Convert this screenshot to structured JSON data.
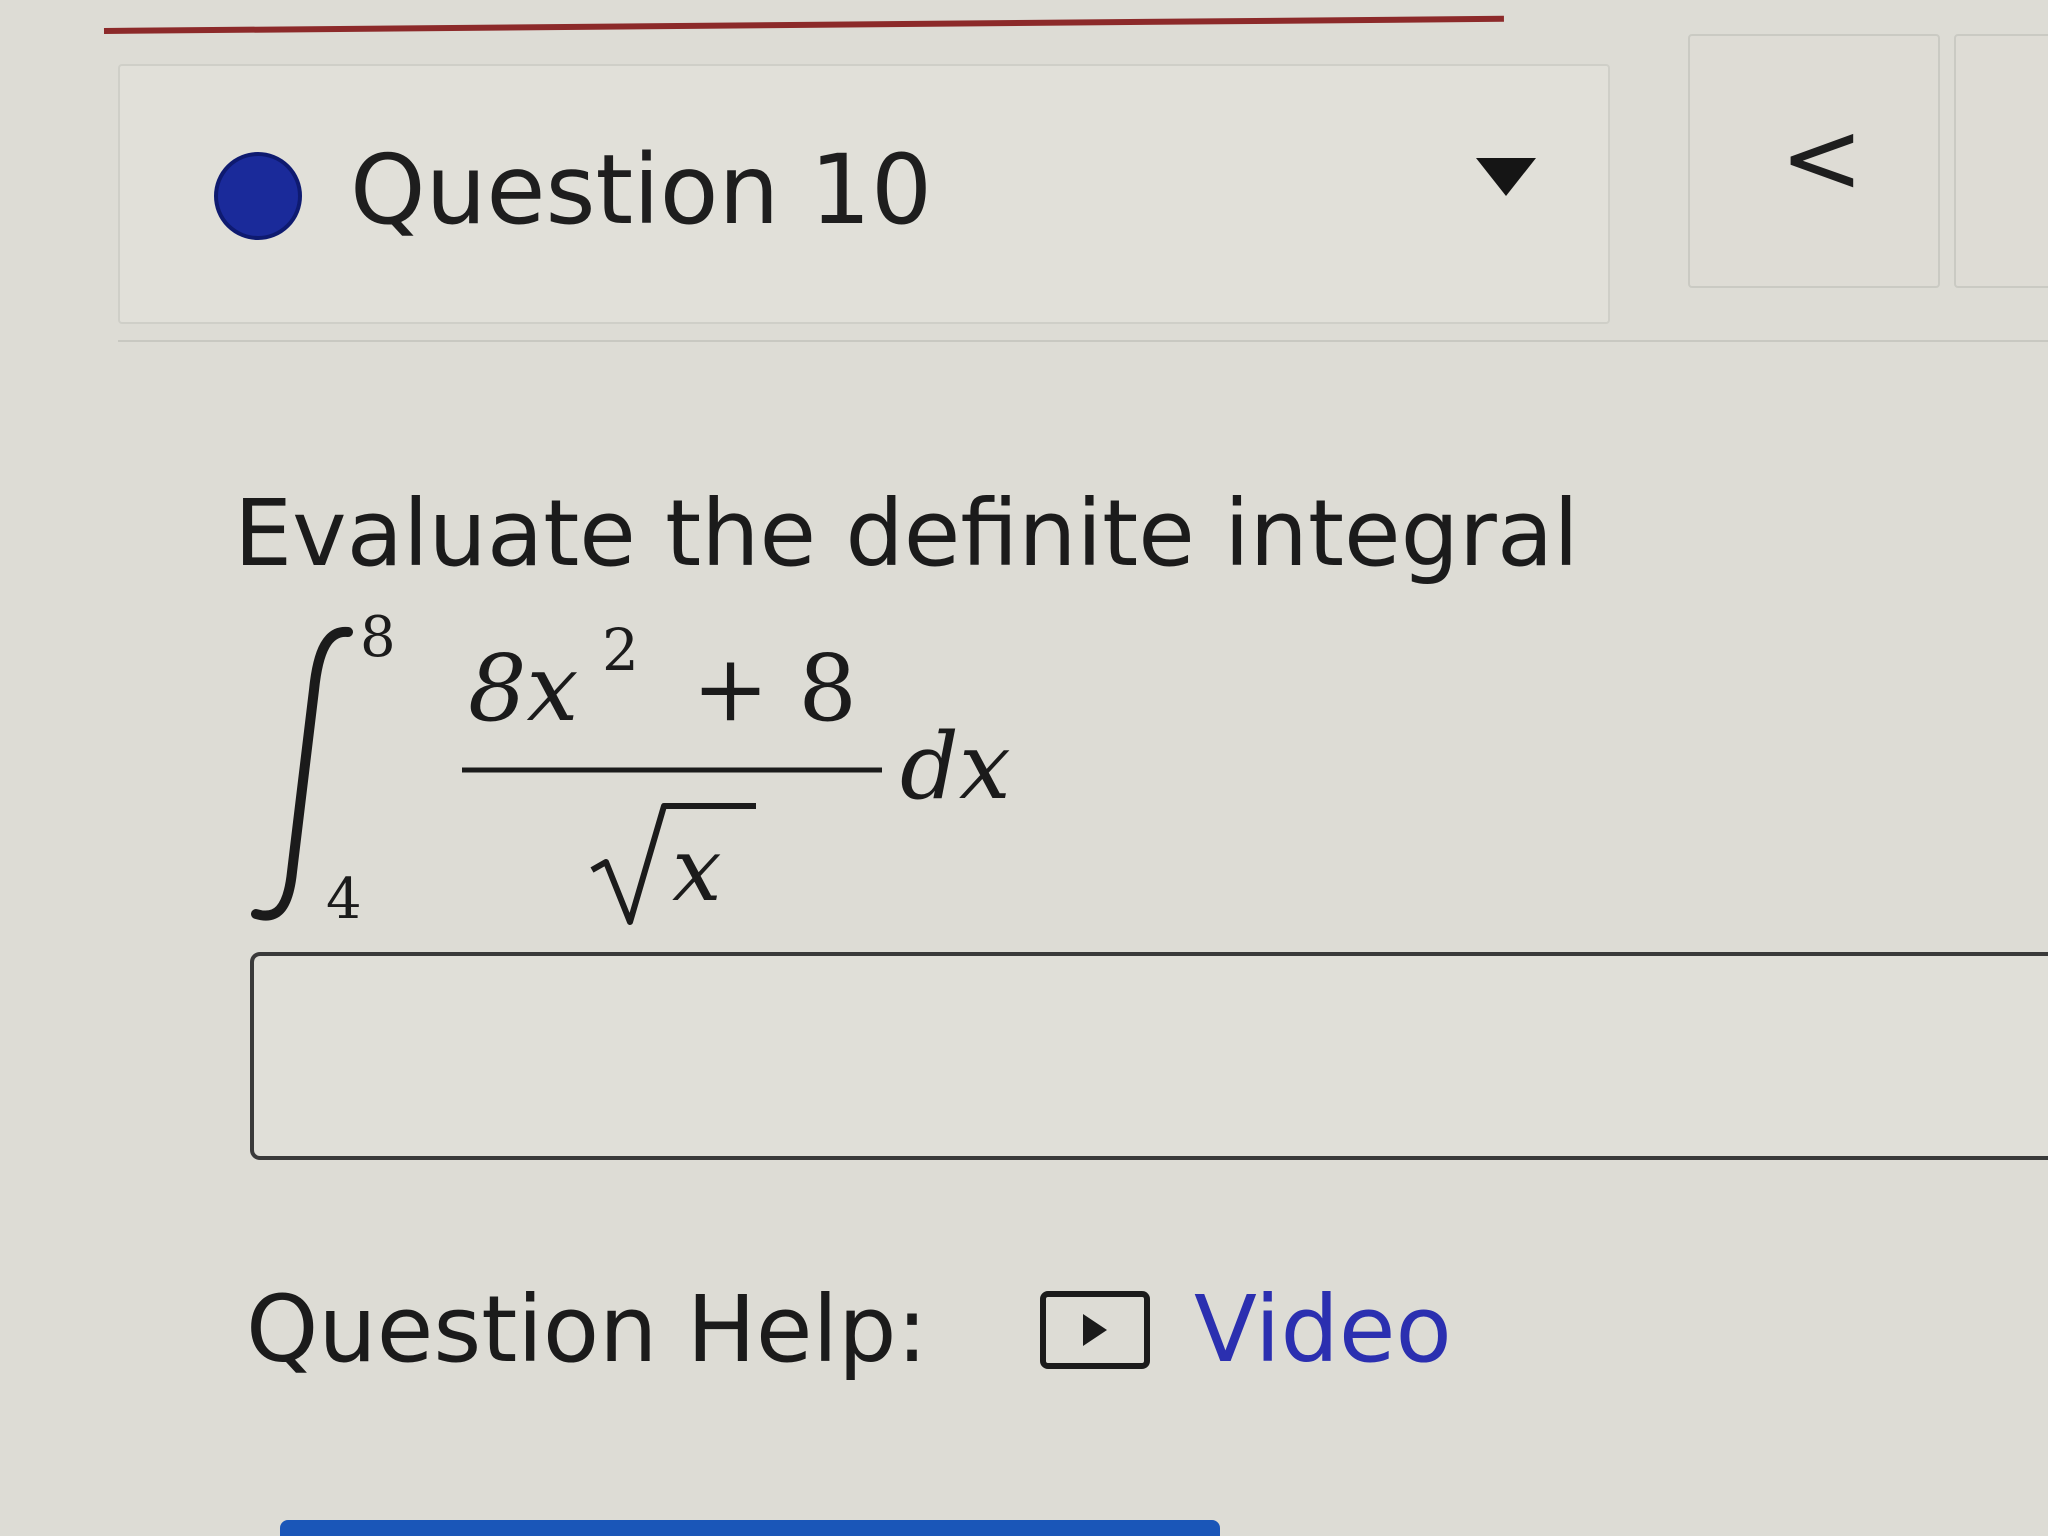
{
  "question": {
    "title": "Question 10",
    "prompt": "Evaluate the definite integral"
  },
  "integral": {
    "lower_limit": "4",
    "upper_limit": "8",
    "numerator_coefficient": "8x",
    "numerator_exponent": "2",
    "numerator_rest": "+ 8",
    "denominator_radicand": "x",
    "differential": "dx"
  },
  "answer": {
    "value": "",
    "placeholder": ""
  },
  "help": {
    "label": "Question Help:",
    "video_label": "Video"
  },
  "navigation": {
    "prev_label": "<"
  },
  "colors": {
    "status_dot": "#1a2a9a",
    "link": "#2b2fb0",
    "top_rule": "#8c2a2a",
    "bottom_bar": "#1a56b8"
  }
}
